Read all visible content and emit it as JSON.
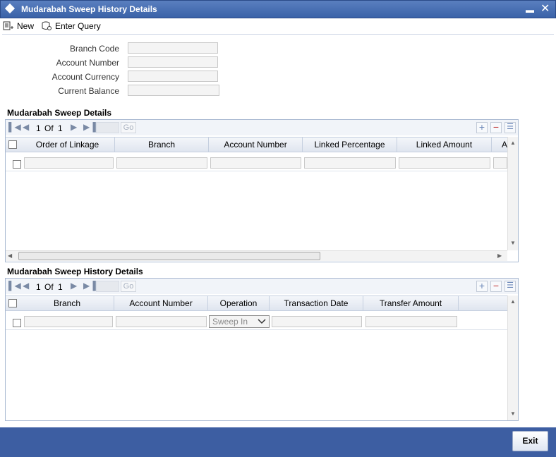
{
  "window": {
    "title": "Mudarabah Sweep History Details"
  },
  "toolbar": {
    "new_label": "New",
    "enter_query_label": "Enter Query"
  },
  "form": {
    "fields": [
      {
        "label": "Branch Code",
        "value": ""
      },
      {
        "label": "Account Number",
        "value": ""
      },
      {
        "label": "Account Currency",
        "value": ""
      },
      {
        "label": "Current Balance",
        "value": ""
      }
    ]
  },
  "sweep_details": {
    "title": "Mudarabah Sweep Details",
    "nav": {
      "current": "1",
      "of": "Of",
      "total": "1",
      "go": "Go"
    },
    "columns": [
      "Order of Linkage",
      "Branch",
      "Account Number",
      "Linked Percentage",
      "Linked Amount",
      "A"
    ]
  },
  "history_details": {
    "title": "Mudarabah Sweep History Details",
    "nav": {
      "current": "1",
      "of": "Of",
      "total": "1",
      "go": "Go"
    },
    "columns": [
      "Branch",
      "Account Number",
      "Operation",
      "Transaction Date",
      "Transfer Amount"
    ],
    "row": {
      "operation": "Sweep In"
    }
  },
  "footer": {
    "exit_label": "Exit"
  }
}
